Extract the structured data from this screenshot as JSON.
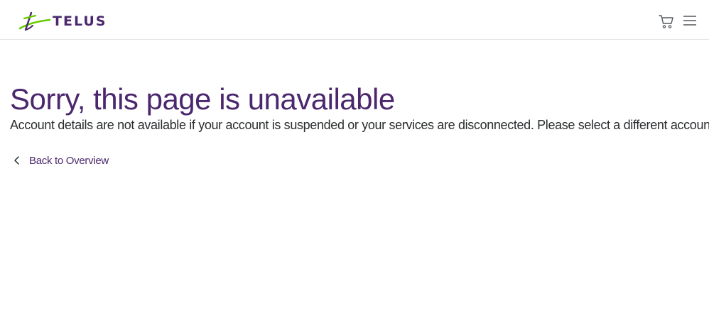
{
  "header": {
    "logo_text": "TELUS",
    "cart_icon": "cart-icon",
    "menu_icon": "hamburger-menu-icon"
  },
  "main": {
    "title": "Sorry, this page is unavailable",
    "message": "Account details are not available if your account is suspended or your services are disconnected. Please select a different account.",
    "back_link_label": "Back to Overview",
    "back_icon": "chevron-left-icon"
  },
  "colors": {
    "brand_purple": "#4b286d",
    "brand_green": "#66cc00",
    "text": "#2a2c2e",
    "divider": "#e3e3e3"
  }
}
